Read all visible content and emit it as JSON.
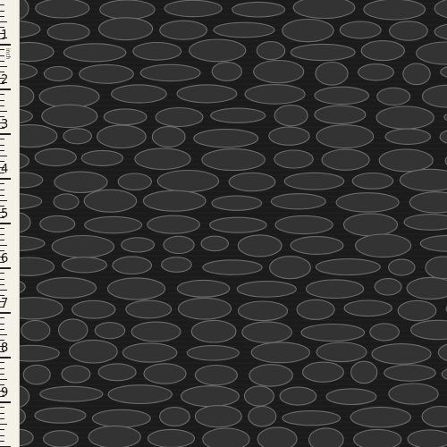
{
  "image": {
    "subject": "fabric-swatch",
    "colors": {
      "background": "#1b1b1b",
      "oval_fill": "#333333",
      "oval_edge": "#6c6c6c",
      "ruler": "#f4f1e8"
    }
  },
  "ruler": {
    "unit_label": "inch",
    "brand_text": "",
    "numbers": [
      "1",
      "2",
      "3",
      "4",
      "5",
      "6",
      "7",
      "8",
      "9"
    ]
  }
}
